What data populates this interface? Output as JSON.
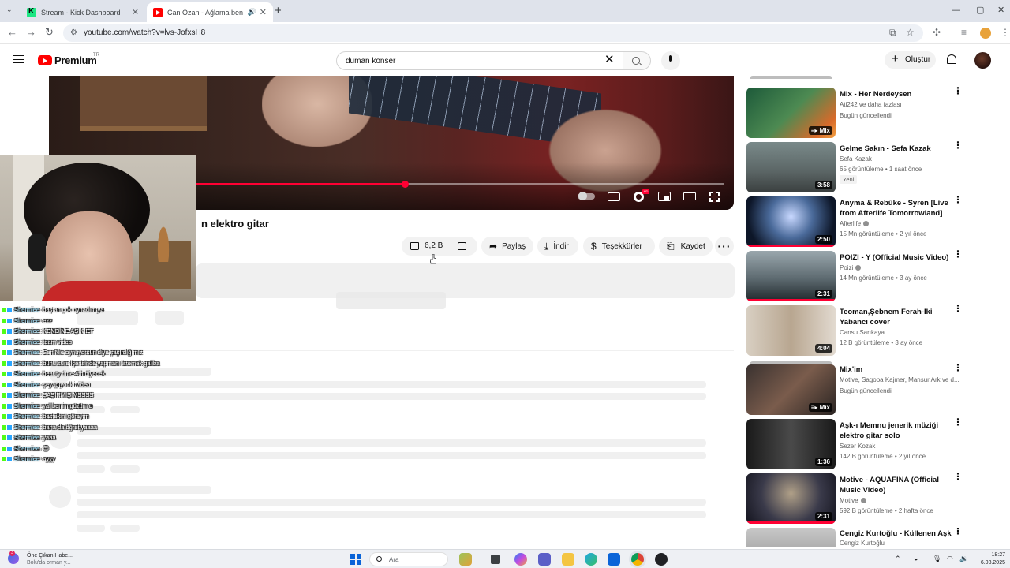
{
  "browser": {
    "tabs": [
      {
        "title": "Stream - Kick Dashboard",
        "active": false
      },
      {
        "title": "Can Ozan - Ağlama ben ağl",
        "active": true
      }
    ],
    "url": "youtube.com/watch?v=lvs-JofxsH8"
  },
  "youtube": {
    "logo_text": "Premium",
    "logo_region": "TR",
    "search_value": "duman konser",
    "create_label": "Oluştur"
  },
  "video": {
    "title_visible": "n elektro gitar",
    "progress": 0.52,
    "like_count": "6,2 B",
    "share_label": "Paylaş",
    "download_label": "İndir",
    "thanks_label": "Teşekkürler",
    "save_label": "Kaydet"
  },
  "chat": [
    {
      "user": "Shermiee",
      "message": "baştan çok oynadım ya"
    },
    {
      "user": "Shermiee",
      "message": "ezz"
    },
    {
      "user": "Shermiee",
      "message": "KENDİNE AŞIK ET"
    },
    {
      "user": "Shermiee",
      "message": "team video"
    },
    {
      "user": "Shermiee",
      "message": "Sen Nie oynuyorsun diye şaşırdığımız"
    },
    {
      "user": "Shermiee",
      "message": "bunu süre içerisinde yapmanı istemek galiba"
    },
    {
      "user": "Shermiee",
      "message": "beauty time 4th diyecek"
    },
    {
      "user": "Shermiee",
      "message": "şeyapıyor ki video"
    },
    {
      "user": "Shermiee",
      "message": "ŞAŞIRMIŞIMSSSS"
    },
    {
      "user": "Shermiee",
      "message": "yal benim gözüm o"
    },
    {
      "user": "Shermiee",
      "message": "bestekini göreyim"
    },
    {
      "user": "Shermiee",
      "message": "bana da öğret yaaaa"
    },
    {
      "user": "Shermiee",
      "message": "yaaa"
    },
    {
      "user": "Shermiee",
      "message": "😊"
    },
    {
      "user": "Shermiee",
      "message": "ayyy"
    }
  ],
  "recommendations": [
    {
      "title": "Mix - Her Nerdeysen",
      "meta1": "Ati242 ve daha fazlası",
      "meta2": "Bugün güncellendi",
      "badge": "Mix",
      "duration": "",
      "new": "",
      "verified": false,
      "progress": 0
    },
    {
      "title": "Gelme Sakın - Sefa Kazak",
      "meta1": "Sefa Kazak",
      "meta2": "65 görüntüleme • 1 saat önce",
      "badge": "",
      "duration": "3:58",
      "new": "Yeni",
      "verified": false,
      "progress": 0
    },
    {
      "title": "Anyma & Rebūke - Syren [Live from Afterlife Tomorrowland]",
      "meta1": "Afterlife",
      "meta2": "15 Mn görüntüleme • 2 yıl önce",
      "badge": "",
      "duration": "2:50",
      "new": "",
      "verified": true,
      "progress": 1
    },
    {
      "title": "POIZI - Y (Official Music Video)",
      "meta1": "Poizi",
      "meta2": "14 Mn görüntüleme • 3 ay önce",
      "badge": "",
      "duration": "2:31",
      "new": "",
      "verified": true,
      "progress": 1
    },
    {
      "title": "Teoman,Şebnem Ferah-İki Yabancı cover",
      "meta1": "Cansu Sarıkaya",
      "meta2": "12 B görüntüleme • 3 ay önce",
      "badge": "",
      "duration": "4:04",
      "new": "",
      "verified": false,
      "progress": 0
    },
    {
      "title": "Mix'im",
      "meta1": "Motive, Sagopa Kajmer, Mansur Ark ve d...",
      "meta2": "Bugün güncellendi",
      "badge": "Mix",
      "duration": "",
      "new": "",
      "verified": false,
      "progress": 0
    },
    {
      "title": "Aşk-ı Memnu jenerik müziği elektro gitar solo",
      "meta1": "Sezer Kozak",
      "meta2": "142 B görüntüleme • 2 yıl önce",
      "badge": "",
      "duration": "1:36",
      "new": "",
      "verified": false,
      "progress": 0
    },
    {
      "title": "Motive - AQUAFINA (Official Music Video)",
      "meta1": "Motive",
      "meta2": "592 B görüntüleme • 2 hafta önce",
      "badge": "",
      "duration": "2:31",
      "new": "",
      "verified": true,
      "progress": 1
    },
    {
      "title": "Cengiz Kurtoğlu - Küllenen Aşk",
      "meta1": "Cengiz Kurtoğlu",
      "meta2": "",
      "badge": "",
      "duration": "",
      "new": "",
      "verified": false,
      "progress": 0
    }
  ],
  "taskbar": {
    "news_title": "Öne Çıkan Habe...",
    "news_sub": "Bolu'da orman y...",
    "news_count": "3",
    "search_placeholder": "Ara",
    "time": "18:27",
    "date": "6.08.2025"
  },
  "colors": {
    "accent_red": "#ff0033",
    "kick_green": "#53fc18"
  }
}
